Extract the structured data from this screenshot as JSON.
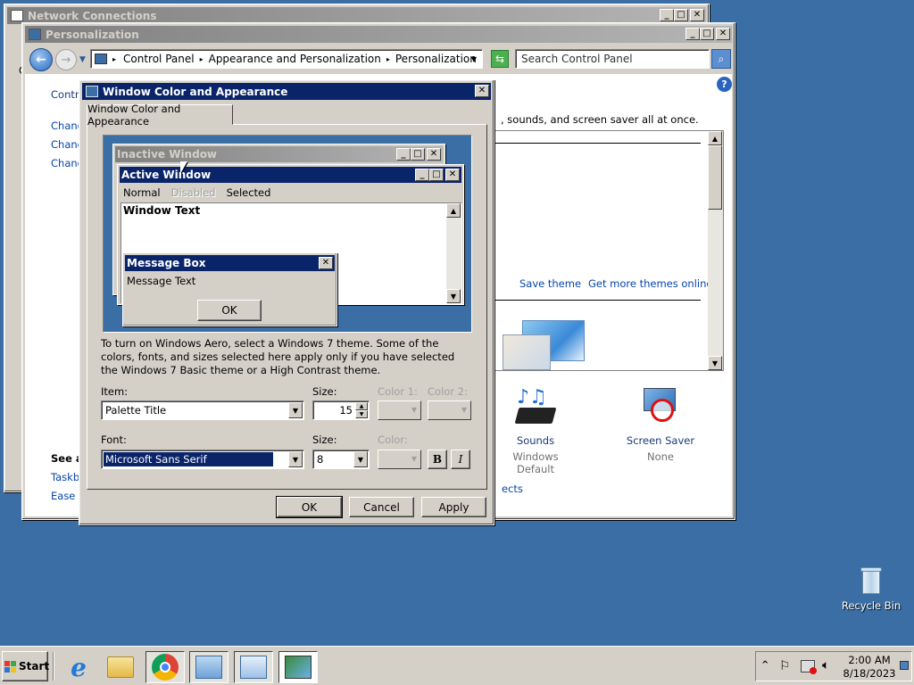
{
  "network_window": {
    "title": "Network Connections",
    "partial_letter": "C"
  },
  "personalization": {
    "title": "Personalization",
    "breadcrumb": [
      "Control Panel",
      "Appearance and Personalization",
      "Personalization"
    ],
    "search_placeholder": "Search Control Panel",
    "left_links": {
      "home": "Control",
      "change1": "Chang",
      "change2": "Chang",
      "change3": "Chang"
    },
    "see_also": {
      "title": "See a",
      "taskbar": "Taskba",
      "ease": "Ease o"
    },
    "intro_text": ", sounds, and screen saver all at once.",
    "save_theme": "Save theme",
    "get_more": "Get more themes online",
    "sounds": {
      "label": "Sounds",
      "value": "Windows Default"
    },
    "screensaver": {
      "label": "Screen Saver",
      "value": "None"
    },
    "effects_link": "ects"
  },
  "dialog": {
    "title": "Window Color and Appearance",
    "tab": "Window Color and Appearance",
    "preview": {
      "inactive_title": "Inactive Window",
      "active_title": "Active Window",
      "menu_normal": "Normal",
      "menu_disabled": "Disabled",
      "menu_selected": "Selected",
      "window_text": "Window Text",
      "msgbox_title": "Message Box",
      "msgbox_text": "Message Text",
      "msgbox_ok": "OK"
    },
    "info_text": "To turn on Windows Aero, select a Windows 7 theme.  Some of the colors, fonts, and sizes selected here apply only if you have selected the Windows 7 Basic theme or a High Contrast theme.",
    "item_label": "Item:",
    "item_value": "Palette Title",
    "size_label": "Size:",
    "size_value": "15",
    "color1_label": "Color 1:",
    "color2_label": "Color 2:",
    "font_label": "Font:",
    "font_value": "Microsoft Sans Serif",
    "font_size_label": "Size:",
    "font_size_value": "8",
    "color_label": "Color:",
    "bold": "B",
    "italic": "I",
    "ok": "OK",
    "cancel": "Cancel",
    "apply": "Apply"
  },
  "desktop": {
    "recycle_bin": "Recycle Bin"
  },
  "taskbar": {
    "start": "Start",
    "time": "2:00 AM",
    "date": "8/18/2023"
  }
}
